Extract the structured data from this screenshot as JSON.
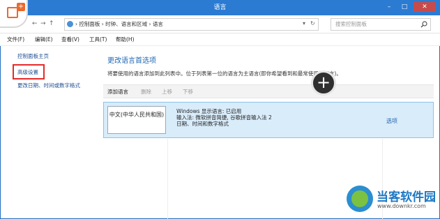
{
  "window": {
    "title": "语言"
  },
  "window_buttons": {
    "minimize": "–",
    "maximize": "□",
    "close": "✕"
  },
  "address": {
    "back": "←",
    "forward": "→",
    "up": "↑",
    "path": "› 控制面板 › 时钟、语言和区域 › 语言",
    "refresh": "↻",
    "search_placeholder": "搜索控制面板"
  },
  "menu": [
    {
      "label": "文件(F)"
    },
    {
      "label": "编辑(E)"
    },
    {
      "label": "查看(V)"
    },
    {
      "label": "工具(T)"
    },
    {
      "label": "帮助(H)"
    }
  ],
  "left_pane": {
    "home": "控制面板主页",
    "advanced": "高级设置",
    "datetime": "更改日期、时间或数字格式"
  },
  "main": {
    "title": "更改语言首选项",
    "desc": "将要使用的语言添加到此列表中。位于列表第一位的语言为主语言(即你希望看到和最常使用的语言)。",
    "toolbar": {
      "add": "添加语言",
      "remove": "删除",
      "up": "上移",
      "down": "下移"
    },
    "language": {
      "name": "中文(中华人民共和国)",
      "line1": "Windows 显示语言: 已启用",
      "line2": "输入法: 微软拼音简捷, 谷歌拼音输入法 2",
      "line3": "日期、时间和数字格式",
      "options": "选项"
    }
  },
  "overlay": {
    "plus": "+"
  },
  "watermark": {
    "title": "当客软件园",
    "url": "www.downkr.com"
  },
  "colors": {
    "titlebar": "#2b7bd3",
    "selected_row": "#d9ecfa",
    "link": "#1d4f91",
    "highlight_box": "#e52a2a"
  }
}
